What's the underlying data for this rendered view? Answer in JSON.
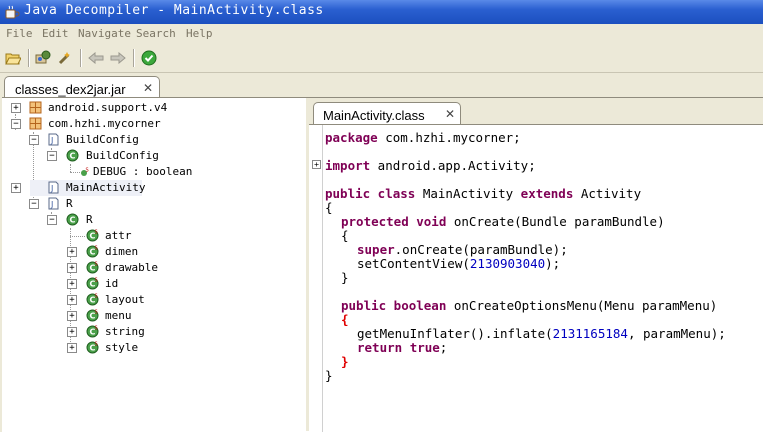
{
  "window": {
    "title": "Java Decompiler - MainActivity.class"
  },
  "menu": [
    "File",
    "Edit",
    "Navigate",
    "Search",
    "Help"
  ],
  "toolbar": {
    "open": "open-folder-icon",
    "back": "back-arrow-icon",
    "forward": "forward-arrow-icon"
  },
  "outer_tab": {
    "label": "classes_dex2jar.jar",
    "close": "✕"
  },
  "editor_tab": {
    "label": "MainActivity.class",
    "close": "✕"
  },
  "tree": {
    "n1": "android.support.v4",
    "n2": "com.hzhi.mycorner",
    "n3": "BuildConfig",
    "n4": "BuildConfig",
    "n5": "DEBUG : boolean",
    "n6": "MainActivity",
    "n7": "R",
    "n8": "R",
    "n9": "attr",
    "n10": "dimen",
    "n11": "drawable",
    "n12": "id",
    "n13": "layout",
    "n14": "menu",
    "n15": "string",
    "n16": "style"
  },
  "code": {
    "l1_kw": "package",
    "l1_rest": " com.hzhi.mycorner;",
    "l2_kw": "import",
    "l2_rest": " android.app.Activity;",
    "l3_kw1": "public class",
    "l3_mid": " MainActivity ",
    "l3_kw2": "extends",
    "l3_rest": " Activity",
    "l4": "{",
    "l5_kw": "protected void",
    "l5_rest": " onCreate(Bundle paramBundle)",
    "l6": "{",
    "l7_kw": "super",
    "l7_rest": ".onCreate(paramBundle);",
    "l8_a": "setContentView(",
    "l8_num": "2130903040",
    "l8_b": ");",
    "l9": "}",
    "l10_kw": "public boolean",
    "l10_rest": " onCreateOptionsMenu(Menu paramMenu)",
    "l11": "{",
    "l12_a": "getMenuInflater().inflate(",
    "l12_num": "2131165184",
    "l12_b": ", paramMenu);",
    "l13_kw1": "return",
    "l13_kw2": "true",
    "l13_b": ";",
    "l14": "}",
    "l15": "}"
  }
}
